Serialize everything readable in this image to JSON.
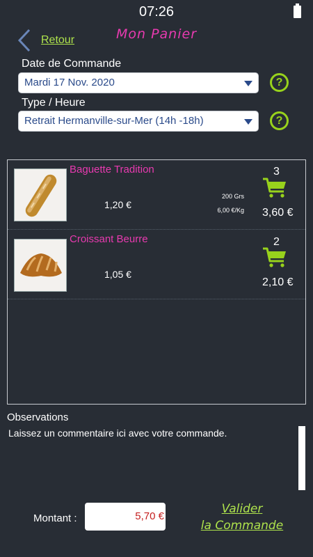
{
  "status": {
    "time": "07:26"
  },
  "header": {
    "back_label": "Retour",
    "title": "Mon Panier"
  },
  "order": {
    "date_label": "Date de Commande",
    "date_value": "Mardi 17 Nov. 2020",
    "type_label": "Type / Heure",
    "type_value": "Retrait Hermanville-sur-Mer (14h -18h)",
    "help_glyph": "?"
  },
  "cart": {
    "items": [
      {
        "name": "Baguette Tradition",
        "unit_price": "1,20 €",
        "weight": "200 Grs",
        "price_per_kg": "6,00 €/Kg",
        "quantity": "3",
        "total": "3,60 €",
        "icon": "shopping-cart-icon"
      },
      {
        "name": "Croissant Beurre",
        "unit_price": "1,05 €",
        "weight": "",
        "price_per_kg": "",
        "quantity": "2",
        "total": "2,10 €",
        "icon": "shopping-cart-icon"
      }
    ]
  },
  "observations": {
    "label": "Observations",
    "placeholder": "Laissez un commentaire ici avec votre commande."
  },
  "footer": {
    "montant_label": "Montant :",
    "montant_value": "5,70 €",
    "validate_line1": "Valider",
    "validate_line2": "la Commande"
  },
  "colors": {
    "background": "#282d35",
    "accent_green": "#aee34c",
    "title_pink": "#e83ab0",
    "amount_red": "#c51f1f"
  }
}
